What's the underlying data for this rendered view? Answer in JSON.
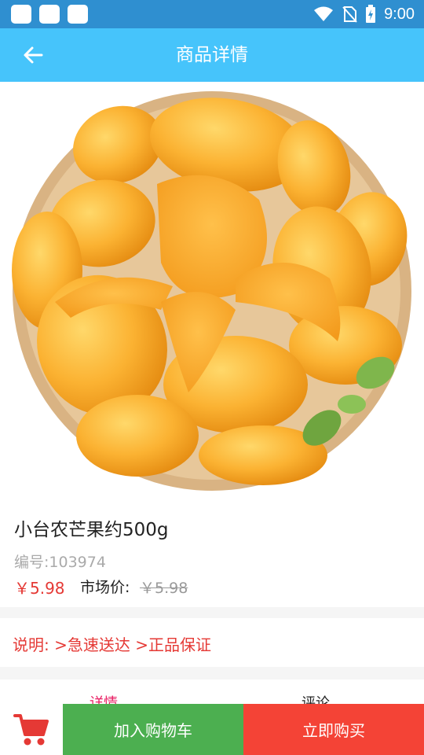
{
  "header": {
    "title": "商品详情"
  },
  "status_bar": {
    "time": "9:00"
  },
  "product": {
    "name": "小台农芒果约500g",
    "code": "编号:103974",
    "price": "￥5.98",
    "market_label": "市场价:",
    "market_price": "￥5.98"
  },
  "notice": {
    "text": "说明: >急速送达 >正品保证"
  },
  "tabs": {
    "detail": "详情",
    "reviews": "评论"
  },
  "actions": {
    "add_to_cart": "加入购物车",
    "buy_now": "立即购买"
  },
  "colors": {
    "app_bar": "#46c4fb",
    "status_bar": "#2f8fd0",
    "price": "#e53935",
    "add_cart": "#4caf50",
    "buy_now": "#f44336"
  }
}
